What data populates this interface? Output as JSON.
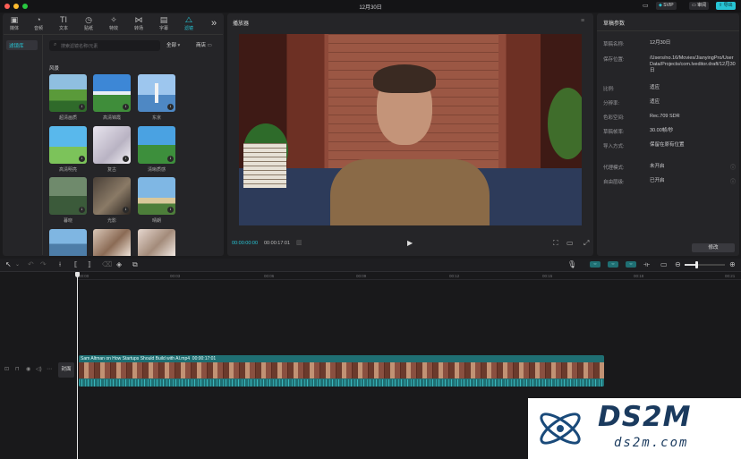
{
  "window": {
    "title": "12月30日"
  },
  "titlebar_right": {
    "svip": "SVIP",
    "review": "审阅",
    "export": "导出"
  },
  "media_toolbar": {
    "items": [
      {
        "label": "媒体",
        "icon": "media-icon"
      },
      {
        "label": "音频",
        "icon": "audio-icon"
      },
      {
        "label": "文本",
        "icon": "text-icon"
      },
      {
        "label": "贴纸",
        "icon": "sticker-icon"
      },
      {
        "label": "特效",
        "icon": "effects-icon"
      },
      {
        "label": "转场",
        "icon": "transition-icon"
      },
      {
        "label": "字幕",
        "icon": "subtitle-icon"
      },
      {
        "label": "滤镜",
        "icon": "filter-icon",
        "active": true
      }
    ],
    "more": "»"
  },
  "sidebar": {
    "active_item": "滤镜库"
  },
  "filters": {
    "search_placeholder": "搜索滤镜名称/元素",
    "all_label": "全部",
    "shop_label": "商店",
    "category": "风景",
    "items": [
      {
        "label": "超清画质"
      },
      {
        "label": "高清锦霞"
      },
      {
        "label": "东京"
      },
      {
        "label": "高清明亮"
      },
      {
        "label": "复古"
      },
      {
        "label": "清晰质感"
      },
      {
        "label": "暮晓"
      },
      {
        "label": "光影"
      },
      {
        "label": "晴朗"
      },
      {
        "label": ""
      },
      {
        "label": ""
      },
      {
        "label": ""
      }
    ]
  },
  "player": {
    "title": "播放器",
    "current_time": "00:00:00:00",
    "total_time": "00:00:17:01"
  },
  "draft_props": {
    "title": "草稿参数",
    "rows": [
      {
        "key": "草稿名称:",
        "value": "12月30日"
      },
      {
        "key": "保存位置:",
        "value": "/Users/no.16/Movies/JianyingPro/User Data/Projects/com.lveditor.draft/12月30日"
      },
      {
        "key": "比例:",
        "value": "适应"
      },
      {
        "key": "分辨率:",
        "value": "适应"
      },
      {
        "key": "色彩空间:",
        "value": "Rec.709 SDR"
      },
      {
        "key": "草稿帧率:",
        "value": "30.00帧/秒"
      },
      {
        "key": "导入方式:",
        "value": "保留在原有位置"
      },
      {
        "key": "代理模式:",
        "value": "未开启"
      },
      {
        "key": "自由层级:",
        "value": "已开启"
      }
    ],
    "edit_button": "修改"
  },
  "timeline": {
    "ruler": [
      "00:00",
      "00:03",
      "00:06",
      "00:09",
      "00:12",
      "00:15",
      "00:18",
      "00:21"
    ],
    "cover_label": "封面",
    "clip": {
      "name": "Sam Altman on How Startups Should Build with AI.mp4",
      "duration": "00:00:17:01"
    }
  },
  "watermark": {
    "logo": "DS2M",
    "url": "ds2m.com"
  },
  "colors": {
    "accent": "#27c4d4",
    "clip_bar": "#1f6f73"
  }
}
